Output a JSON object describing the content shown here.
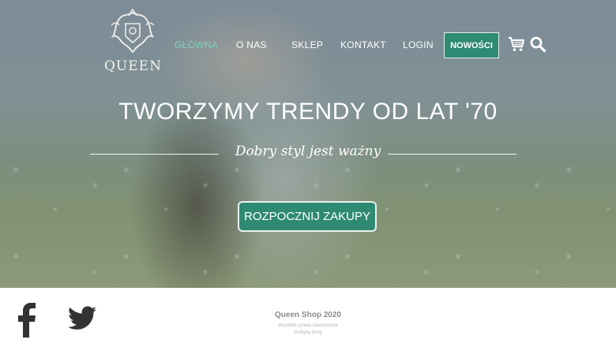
{
  "nav": {
    "logo_text": "QUEEN",
    "items": [
      {
        "label": "GŁÓWNA",
        "active": true
      },
      {
        "label": "O NAS",
        "active": false
      },
      {
        "label": "SKLEP",
        "active": false
      },
      {
        "label": "KONTAKT",
        "active": false
      },
      {
        "label": "LOGIN",
        "active": false
      }
    ],
    "new_button": "NOWOŚCI",
    "cart_icon": "cart-icon",
    "search_icon": "search-icon"
  },
  "hero": {
    "headline": "TWORZYMY TRENDY OD LAT '70",
    "tagline": "Dobry styl jest ważny",
    "cta": "ROZPOCZNIJ ZAKUPY"
  },
  "footer": {
    "shop_name": "Queen Shop 2020",
    "rights": "Wszelkie prawa zastrzeżone",
    "policy": "Polityka firmy",
    "social_icons": [
      "facebook-icon",
      "twitter-icon"
    ]
  },
  "colors": {
    "accent": "#2f8a73",
    "active_link": "#7fd3bb"
  }
}
